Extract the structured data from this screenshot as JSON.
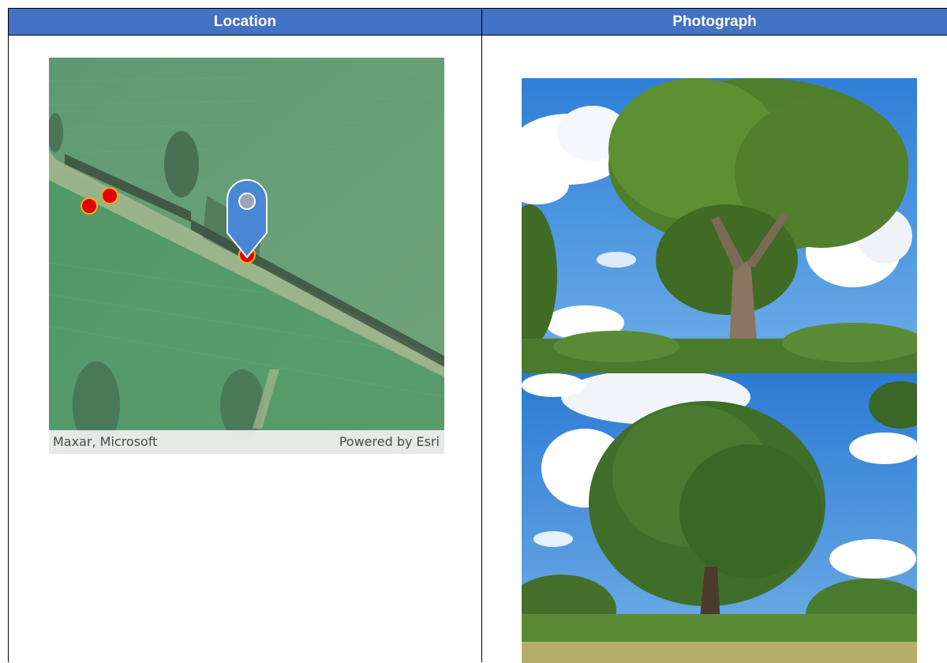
{
  "table": {
    "headers": {
      "location": "Location",
      "photograph": "Photograph"
    }
  },
  "map": {
    "attribution_left": "Maxar, Microsoft",
    "attribution_right": "Powered by Esri",
    "marker_icon": "map-pin-icon",
    "point_color": "#e00000",
    "pin_color": "#4a86d4"
  },
  "photos": {
    "photo_1": "tree-photo",
    "photo_2": "tree-photo"
  },
  "colors": {
    "header_bg": "#4472c4",
    "header_text": "#ffffff"
  }
}
